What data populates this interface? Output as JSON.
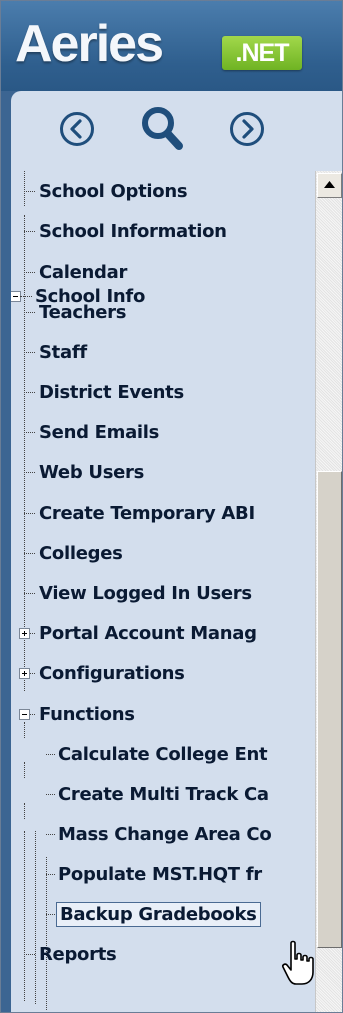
{
  "logo": {
    "text": "Aeries",
    "badge": ".NET"
  },
  "nav": {
    "back_icon": "circle-chevron-left-icon",
    "search_icon": "magnifier-icon",
    "forward_icon": "circle-chevron-right-icon"
  },
  "tree": {
    "root": {
      "label": "School Info",
      "state": "expanded"
    },
    "items": [
      {
        "label": "School Options"
      },
      {
        "label": "School Information"
      },
      {
        "label": "Calendar"
      },
      {
        "label": "Teachers"
      },
      {
        "label": "Staff"
      },
      {
        "label": "District Events"
      },
      {
        "label": "Send Emails"
      },
      {
        "label": "Web Users"
      },
      {
        "label": "Create Temporary ABI"
      },
      {
        "label": "Colleges"
      },
      {
        "label": "View Logged In Users"
      },
      {
        "label": "Portal Account Manag",
        "state": "collapsed"
      },
      {
        "label": "Configurations",
        "state": "collapsed"
      },
      {
        "label": "Functions",
        "state": "expanded"
      },
      {
        "label": "Reports"
      }
    ],
    "functions_children": [
      {
        "label": "Calculate College Ent"
      },
      {
        "label": "Create Multi Track Ca"
      },
      {
        "label": "Mass Change Area Co"
      },
      {
        "label": "Populate MST.HQT fr"
      },
      {
        "label": "Backup Gradebooks",
        "selected": true
      }
    ]
  },
  "colors": {
    "brand_blue": "#3c6592",
    "net_green": "#7dc12c",
    "panel_bg": "#d3deed",
    "nav_blue": "#1f4e7c"
  }
}
